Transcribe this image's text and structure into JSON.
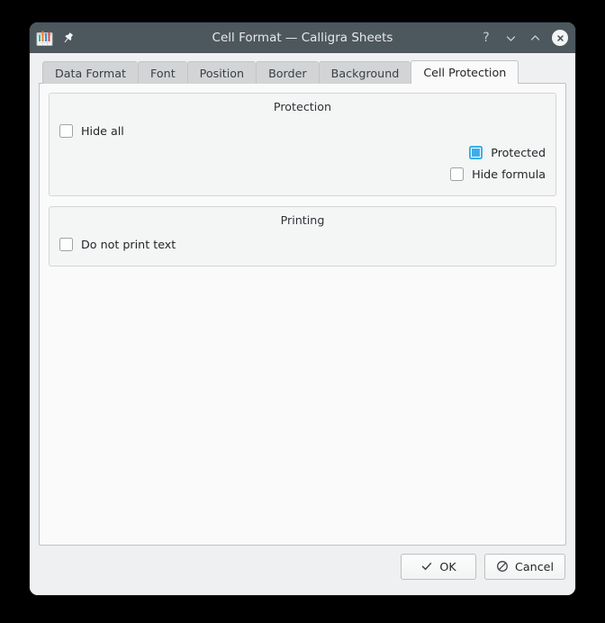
{
  "window": {
    "title": "Cell Format — Calligra Sheets",
    "app_icon": "calligra-sheets-icon",
    "pin_icon": "keep-above-pin-icon",
    "controls": {
      "help_label": "?",
      "help_icon": "help-question-icon",
      "minimize_icon": "chevron-down-icon",
      "maximize_icon": "chevron-up-icon",
      "close_icon": "close-x-icon"
    },
    "colors": {
      "titlebar": "#4d575e",
      "dialog_bg": "#eff0f1",
      "panel_bg": "#fafafa",
      "group_bg": "#f4f5f5",
      "accent": "#3daee9",
      "tab_inactive": "#d2d4d6",
      "border": "#bfc1c3"
    }
  },
  "tabs": [
    {
      "label": "Data Format",
      "active": false
    },
    {
      "label": "Font",
      "active": false
    },
    {
      "label": "Position",
      "active": false
    },
    {
      "label": "Border",
      "active": false
    },
    {
      "label": "Background",
      "active": false
    },
    {
      "label": "Cell Protection",
      "active": true
    }
  ],
  "groups": [
    {
      "title": "Protection",
      "options": [
        {
          "label": "Hide all",
          "checked": false,
          "align": "left"
        },
        {
          "label": "Protected",
          "checked": true,
          "align": "right"
        },
        {
          "label": "Hide formula",
          "checked": false,
          "align": "right"
        }
      ]
    },
    {
      "title": "Printing",
      "options": [
        {
          "label": "Do not print text",
          "checked": false,
          "align": "left"
        }
      ]
    }
  ],
  "footer": {
    "ok_label": "OK",
    "ok_icon": "checkmark-icon",
    "cancel_label": "Cancel",
    "cancel_icon": "no-entry-icon"
  }
}
